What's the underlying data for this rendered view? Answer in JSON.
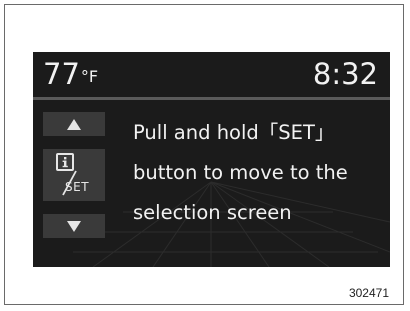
{
  "display": {
    "temperature": "77",
    "temperature_unit": "°F",
    "clock": "8:32",
    "message_lines": [
      "Pull and hold「SET」",
      "button to move to the",
      "selection screen"
    ]
  },
  "controls": {
    "up_icon": "triangle-up-icon",
    "info_icon": "info-icon",
    "set_label": "SET",
    "down_icon": "triangle-down-icon"
  },
  "figure": {
    "id": "302471"
  },
  "colors": {
    "screen_background": "#1b1b1b",
    "text": "#f2f2f2",
    "button_background": "#3a3a3a",
    "divider": "#5a5a5a"
  }
}
